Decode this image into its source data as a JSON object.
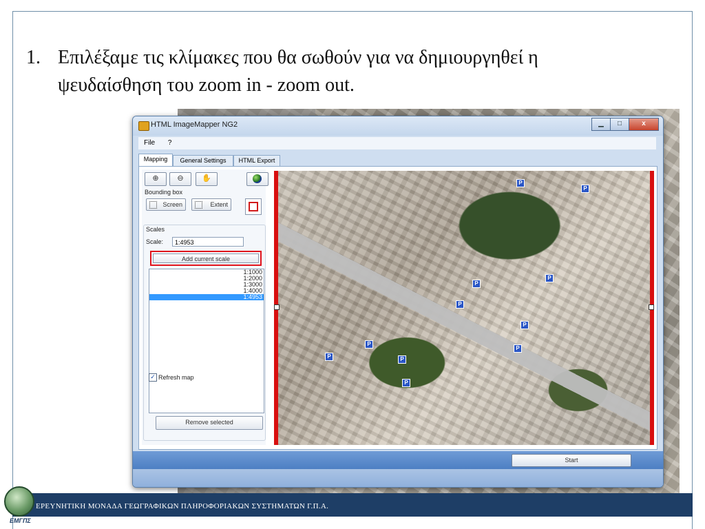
{
  "slide": {
    "bullet_number": "1.",
    "bullet_line1": "Επιλέξαμε τις κλίμακες που θα σωθούν για να  δημιουργηθεί η",
    "bullet_line2": "ψευδαίσθηση του zoom in - zoom out.",
    "footer": "ΕΡΕΥΝΗΤΙΚΗ ΜΟΝΑΔΑ ΓΕΩΓΡΑΦΙΚΩΝ ΠΛΗΡΟΦΟΡΙΑΚΩΝ ΣΥΣΤΗΜΑΤΩΝ Γ.Π.Α.",
    "logo_text": "ΕΜΓΠΣ"
  },
  "window": {
    "title": "HTML ImageMapper NG2",
    "minimize_glyph": "▁",
    "maximize_glyph": "□",
    "close_glyph": "x"
  },
  "menu": {
    "file": "File",
    "help": "?"
  },
  "tabs": {
    "mapping": "Mapping",
    "general": "General Settings",
    "export": "HTML Export"
  },
  "toolbar": {
    "zoom_in_glyph": "⊕",
    "zoom_out_glyph": "⊖",
    "pan_glyph": "✋"
  },
  "bounding_box": {
    "label": "Bounding box",
    "screen": "Screen",
    "extent": "Extent"
  },
  "scales": {
    "group_label": "Scales",
    "scale_label": "Scale:",
    "scale_value": "1:4953",
    "add_button": "Add current scale",
    "items": [
      "1:1000",
      "1:2000",
      "1:3000",
      "1:4000",
      "1:4953"
    ],
    "selected_index": 4,
    "refresh_label": "Refresh map",
    "refresh_checked": true,
    "remove_button": "Remove selected"
  },
  "footer_bar": {
    "start_button": "Start"
  },
  "map": {
    "marker": "P"
  },
  "colors": {
    "highlight_red": "#e0121c",
    "selection_blue": "#3399ff",
    "footer_navy": "#1e3e66"
  }
}
